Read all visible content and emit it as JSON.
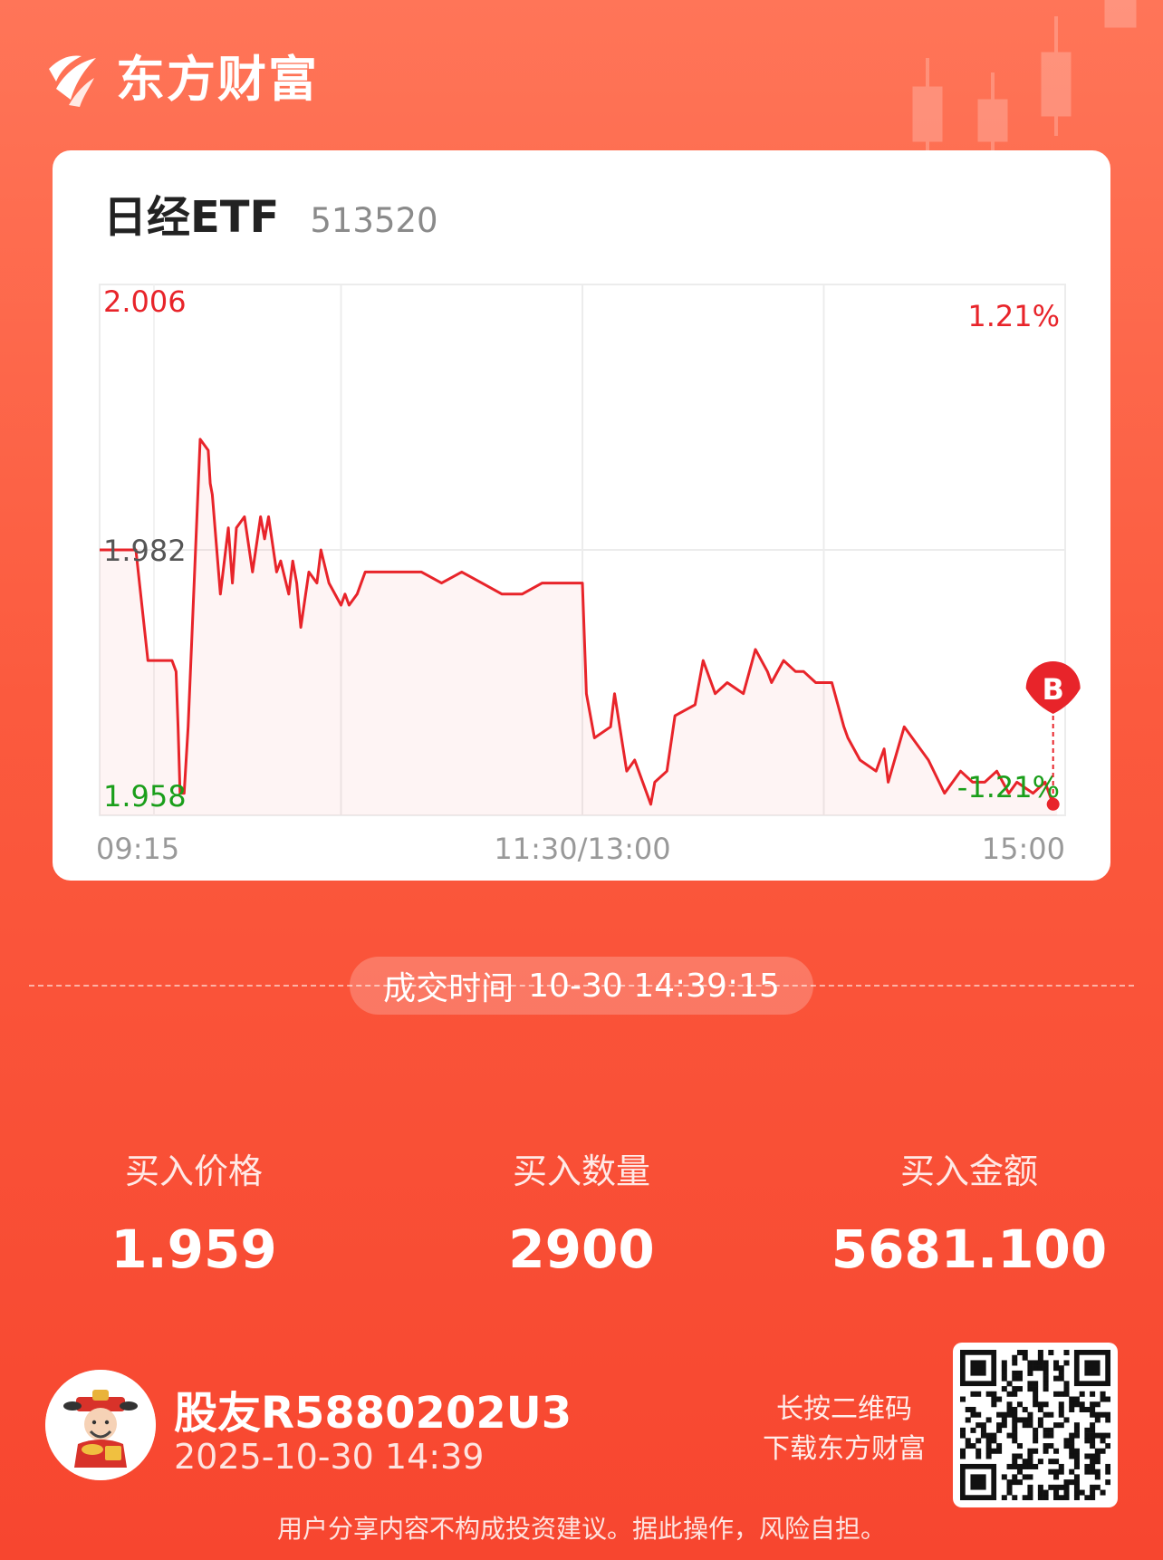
{
  "brand": {
    "name": "东方财富"
  },
  "stock": {
    "name": "日经ETF",
    "code": "513520"
  },
  "chart_data": {
    "type": "line",
    "title": "",
    "xlabel": "",
    "ylabel": "",
    "ylim": [
      1.958,
      2.006
    ],
    "y_tick_labels": {
      "top": "2.006",
      "middle": "1.982",
      "bottom": "1.958"
    },
    "pct_labels": {
      "top": "1.21%",
      "bottom": "-1.21%"
    },
    "x_tick_labels": [
      "09:15",
      "11:30/13:00",
      "15:00"
    ],
    "x_range": [
      0,
      240
    ],
    "reference_price": 1.982,
    "grid": true,
    "series": [
      {
        "x": [
          0,
          8,
          9,
          12,
          13,
          18,
          19,
          19.5,
          20,
          21,
          22,
          25,
          27,
          27.5,
          28,
          30,
          32,
          33,
          34,
          36,
          38,
          40,
          41,
          42,
          44,
          45,
          47,
          48,
          49,
          50,
          52,
          54,
          55,
          57,
          60,
          61,
          62,
          64,
          66,
          68,
          70,
          73,
          75,
          80,
          85,
          90,
          95,
          100,
          105,
          110,
          115,
          120,
          121,
          123,
          127,
          128,
          131,
          133,
          137,
          138,
          141,
          143,
          148,
          150,
          153,
          156,
          160,
          163,
          166,
          167,
          170,
          173,
          175,
          178,
          180,
          182,
          185,
          186,
          189,
          193,
          195,
          196,
          200,
          206,
          210,
          214,
          217,
          220,
          223,
          226,
          228,
          232,
          235,
          236,
          237,
          238
        ],
        "values": [
          1.982,
          1.982,
          1.982,
          1.972,
          1.972,
          1.972,
          1.971,
          1.966,
          1.96,
          1.96,
          1.966,
          1.992,
          1.991,
          1.988,
          1.987,
          1.978,
          1.984,
          1.979,
          1.984,
          1.985,
          1.98,
          1.985,
          1.983,
          1.985,
          1.98,
          1.981,
          1.978,
          1.981,
          1.979,
          1.975,
          1.98,
          1.979,
          1.982,
          1.979,
          1.977,
          1.978,
          1.977,
          1.978,
          1.98,
          1.98,
          1.98,
          1.98,
          1.98,
          1.98,
          1.979,
          1.98,
          1.979,
          1.978,
          1.978,
          1.979,
          1.979,
          1.979,
          1.969,
          1.965,
          1.966,
          1.969,
          1.962,
          1.963,
          1.959,
          1.961,
          1.962,
          1.967,
          1.968,
          1.972,
          1.969,
          1.97,
          1.969,
          1.973,
          1.971,
          1.97,
          1.972,
          1.971,
          1.971,
          1.97,
          1.97,
          1.97,
          1.966,
          1.965,
          1.963,
          1.962,
          1.964,
          1.961,
          1.966,
          1.963,
          1.96,
          1.962,
          1.961,
          1.961,
          1.962,
          1.96,
          1.961,
          1.96,
          1.961,
          1.96,
          1.959,
          1.959
        ]
      }
    ],
    "annotations": [
      {
        "label": "B",
        "x": 237,
        "y": 1.959
      }
    ]
  },
  "trade": {
    "label": "成交时间",
    "time": "10-30 14:39:15"
  },
  "stats": [
    {
      "label": "买入价格",
      "value": "1.959"
    },
    {
      "label": "买入数量",
      "value": "2900"
    },
    {
      "label": "买入金额",
      "value": "5681.100"
    }
  ],
  "user": {
    "name": "股友R5880202U3",
    "date": "2025-10-30 14:39"
  },
  "qr": {
    "hint_line1": "长按二维码",
    "hint_line2": "下载东方财富"
  },
  "disclaimer": "用户分享内容不构成投资建议。据此操作，风险自担。",
  "colors": {
    "up": "#e8242a",
    "down": "#1a9e1a",
    "brand": "#f7462f"
  }
}
